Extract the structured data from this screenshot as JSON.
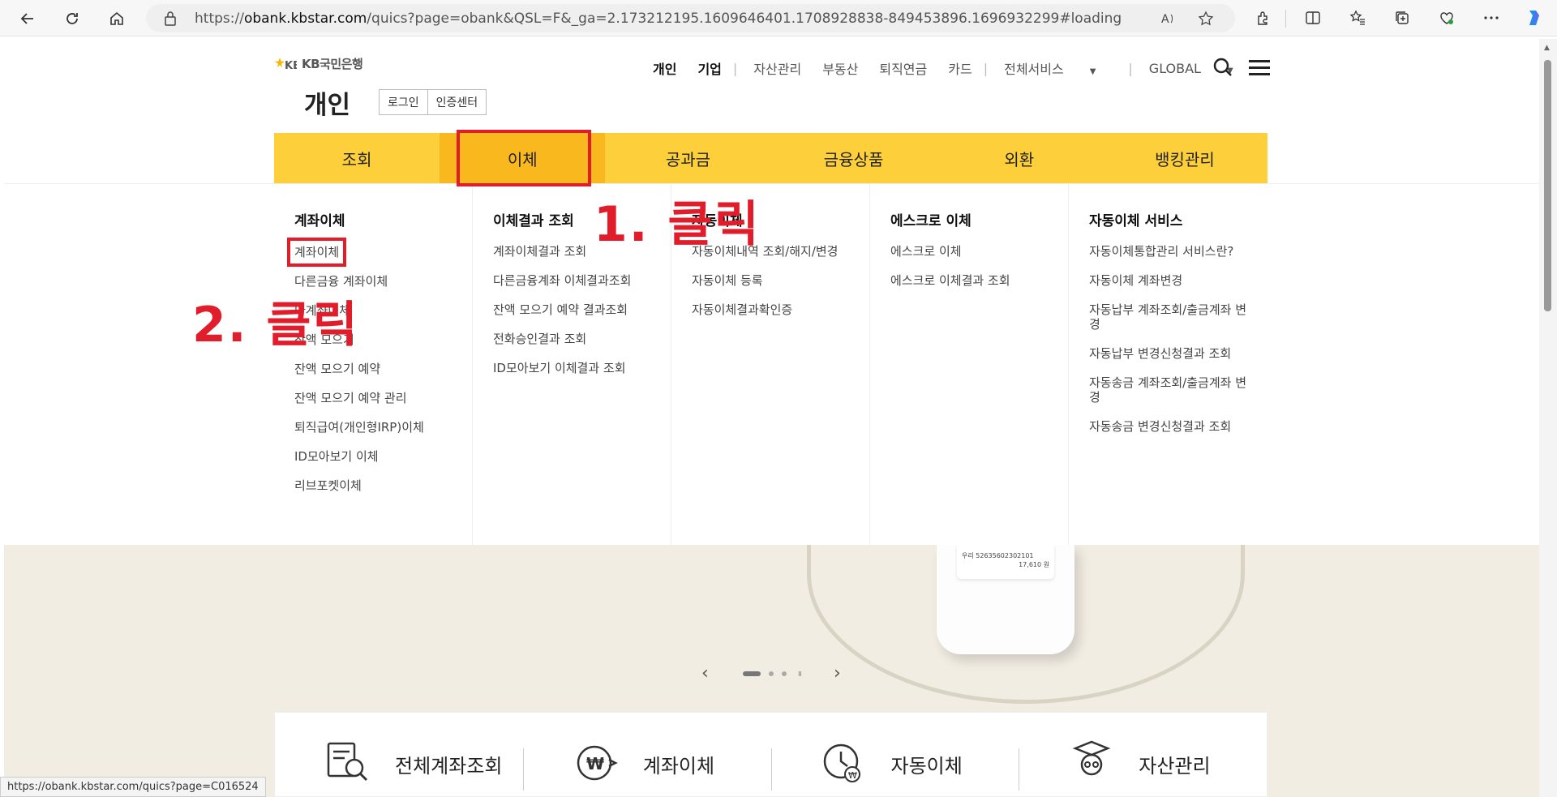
{
  "browser": {
    "url_prefix": "https://",
    "url_host": "obank.kbstar.com",
    "url_rest": "/quics?page=obank&QSL=F&_ga=2.173212195.1609646401.1708928838-849453896.1696932299#loading"
  },
  "site": {
    "logo_text": "KB국민은행",
    "page_title": "개인",
    "login_label": "로그인",
    "cert_label": "인증센터",
    "top_nav": {
      "personal": "개인",
      "business": "기업",
      "asset": "자산관리",
      "realestate": "부동산",
      "pension": "퇴직연금",
      "card": "카드",
      "all_services": "전체서비스",
      "global": "GLOBAL"
    },
    "gnb": [
      "조회",
      "이체",
      "공과금",
      "금융상품",
      "외환",
      "뱅킹관리"
    ]
  },
  "submenu": {
    "col1": {
      "title": "계좌이체",
      "items": [
        "계좌이체",
        "다른금융 계좌이체",
        "다계좌이체",
        "잔액 모으기",
        "잔액 모으기 예약",
        "잔액 모으기 예약 관리",
        "퇴직급여(개인형IRP)이체",
        "ID모아보기 이체",
        "리브포켓이체"
      ]
    },
    "col2": {
      "title": "이체결과 조회",
      "items": [
        "계좌이체결과 조회",
        "다른금융계좌 이체결과조회",
        "잔액 모으기 예약 결과조회",
        "전화승인결과 조회",
        "ID모아보기 이체결과 조회"
      ]
    },
    "col3": {
      "title": "자동이체",
      "items": [
        "자동이체내역 조회/해지/변경",
        "자동이체 등록",
        "자동이체결과확인증"
      ]
    },
    "col4": {
      "title": "에스크로 이체",
      "items": [
        "에스크로 이체",
        "에스크로 이체결과 조회"
      ]
    },
    "col5": {
      "title": "자동이체 서비스",
      "items": [
        "자동이체통합관리 서비스란?",
        "자동이체 계좌변경",
        "자동납부 계좌조회/출금계좌 변경",
        "자동납부 변경신청결과 조회",
        "자동송금 계좌조회/출금계좌 변경",
        "자동송금 변경신청결과 조회"
      ]
    }
  },
  "annotations": {
    "step1": "1. 클릭",
    "step2": "2. 클릭"
  },
  "hero": {
    "phone_account": "우리 52635602302101",
    "phone_amount": "17,610 원"
  },
  "quick_menu": [
    "전체계좌조회",
    "계좌이체",
    "자동이체",
    "자산관리"
  ],
  "status_url": "https://obank.kbstar.com/quics?page=C016524",
  "colors": {
    "gnb": "#fdcf3b",
    "gnb_active": "#f9b81e",
    "annotation": "#e21d2b",
    "hero_bg": "#f2ede3"
  }
}
